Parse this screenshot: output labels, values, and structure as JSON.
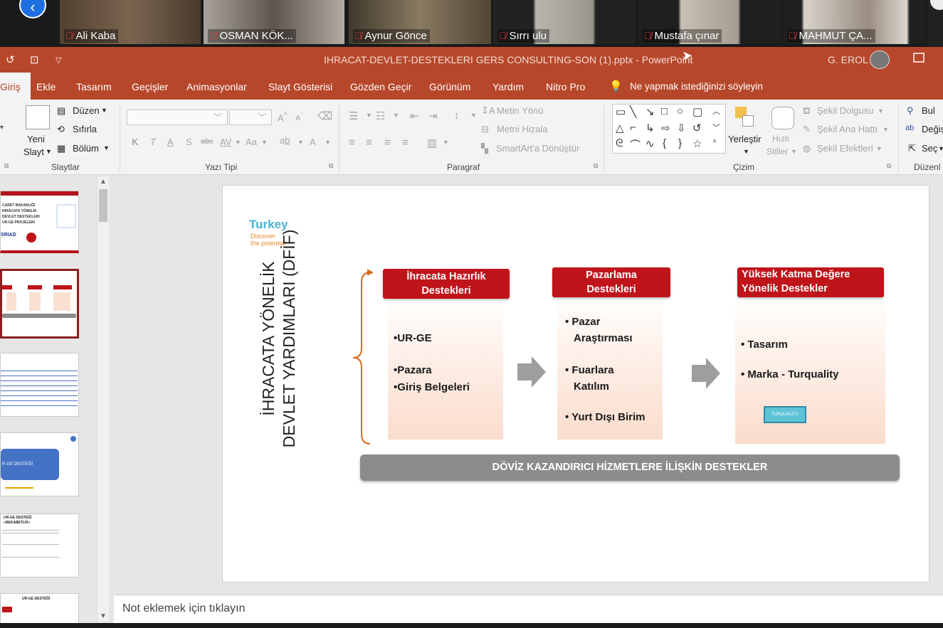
{
  "participants": [
    {
      "name": "Ali Kaba",
      "bg": "#6a5446"
    },
    {
      "name": "OSMAN KÖK...",
      "bg": "#8b8580"
    },
    {
      "name": "Aynur Gönce",
      "bg": "#6f6450"
    },
    {
      "name": "Sırrı ulu",
      "bg": "#9a9a92"
    },
    {
      "name": "Mustafa çınar",
      "bg": "#b8b2a8"
    },
    {
      "name": "MAHMUT ÇA...",
      "bg": "#8d8378"
    }
  ],
  "titlebar": {
    "document": "IHRACAT-DEVLET-DESTEKLERI GERS CONSULTING-SON (1).pptx  -  PowerPoint",
    "user": "G. EROL"
  },
  "tabs": [
    "Giriş",
    "Ekle",
    "Tasarım",
    "Geçişler",
    "Animasyonlar",
    "Slayt Gösterisi",
    "Gözden Geçir",
    "Görünüm",
    "Yardım",
    "Nitro Pro"
  ],
  "tell_me": "Ne yapmak istediğinizi söyleyin",
  "ribbon": {
    "yeni_slayt_1": "Yeni",
    "yeni_slayt_2": "Slayt",
    "duzen": "Düzen",
    "sifirla": "Sıfırla",
    "bolum": "Bölüm",
    "slaytlar": "Slaytlar",
    "bold": "K",
    "italic": "T",
    "underline": "A",
    "shadow": "S",
    "strike": "abc",
    "spacing": "AV",
    "case": "Aa",
    "yazi_tipi": "Yazı Tipi",
    "metin_yonu": "Metin Yönü",
    "metni_hizala": "Metni Hizala",
    "smartart": "SmartArt'a Dönüştür",
    "paragraf": "Paragraf",
    "yerlestir": "Yerleştir",
    "hizli_1": "Hızlı",
    "hizli_2": "Stiller",
    "sekil_dolgusu": "Şekil Dolgusu",
    "sekil_ana_hatti": "Şekil Ana Hattı",
    "sekil_efektleri": "Şekil Efektleri",
    "cizim": "Çizim",
    "bul": "Bul",
    "degistir": "Değiş",
    "sec": "Seç",
    "duzenle": "Düzenl"
  },
  "slide": {
    "vertical_title_1": "İHRACATA YÖNELİK",
    "vertical_title_2": "DEVLET YARDIMLARI (DFİF)",
    "logo_name": "Turkey",
    "logo_tagline_1": "Discover",
    "logo_tagline_2": "the potential",
    "col1_header_1": "İhracata Hazırlık",
    "col1_header_2": "Destekleri",
    "col1_item1": "•UR-GE",
    "col1_item2": "•Pazara",
    "col1_item3": "•Giriş  Belgeleri",
    "col2_header_1": "Pazarlama",
    "col2_header_2": "Destekleri",
    "col2_item1_a": "• Pazar",
    "col2_item1_b": "Araştırması",
    "col2_item2_a": "• Fuarlara",
    "col2_item2_b": "Katılım",
    "col2_item3": "• Yurt Dışı Birim",
    "col3_header_1": "Yüksek Katma Değere",
    "col3_header_2": "Yönelik Destekler",
    "col3_item1": "• Tasarım",
    "col3_item2": "• Marka - Turquality",
    "turquality_logo": "TURQUALITY",
    "banner": "DÖVİZ KAZANDIRICI HİZMETLERE İLİŞKİN DESTEKLER"
  },
  "thumbnails": {
    "t1_lines": [
      "CARET BAKANLIĞI",
      "IHRACATA YÖNELİK",
      "DEVLET DESTEKLERI",
      "UR-GE PROJELERI"
    ],
    "t1_logo": "SRIAD",
    "t4_label": "R-GE DESTEĞİ",
    "t5_title_1": "UR-GE DESTEĞİ",
    "t5_title_2": "«REKABETLİK»",
    "t6_title": "UR-GE DESTEĞİ"
  },
  "notes_placeholder": "Not eklemek için tıklayın",
  "colors": {
    "accent": "#b7472a",
    "slide_red": "#c0141b"
  }
}
